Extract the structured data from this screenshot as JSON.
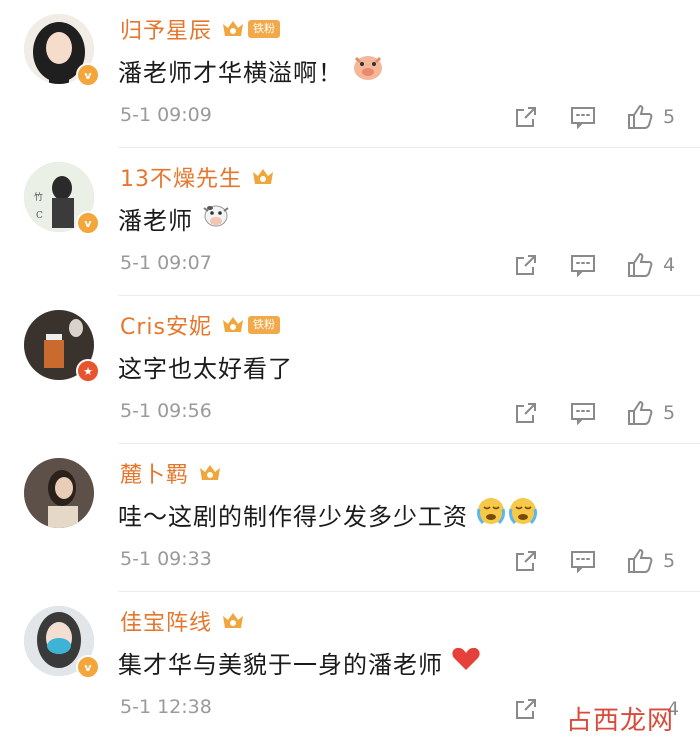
{
  "comments": [
    {
      "name": "归予星辰",
      "fan_tag": "铁粉",
      "text": "潘老师才华横溢啊！",
      "time": "5-1 09:09",
      "likes": "5",
      "badge": "v",
      "badge_color": "#f2a63b",
      "avatar_color": "#2b2b2b",
      "emoji": "pig"
    },
    {
      "name": "13不燥先生",
      "fan_tag": "",
      "text": "潘老师",
      "time": "5-1 09:07",
      "likes": "4",
      "badge": "v",
      "badge_color": "#f2a63b",
      "avatar_color": "#e9efe3",
      "emoji": "cow"
    },
    {
      "name": "Cris安妮",
      "fan_tag": "铁粉",
      "text": "这字也太好看了",
      "time": "5-1 09:56",
      "likes": "5",
      "badge": "star",
      "badge_color": "#e8542e",
      "avatar_color": "#4a4038",
      "emoji": ""
    },
    {
      "name": "麓卜羁",
      "fan_tag": "",
      "text": "哇～这剧的制作得少发多少工资",
      "time": "5-1 09:33",
      "likes": "5",
      "badge": "",
      "badge_color": "",
      "avatar_color": "#6a5a4e",
      "emoji": "cry2"
    },
    {
      "name": "佳宝阵线",
      "fan_tag": "",
      "text": "集才华与美貌于一身的潘老师",
      "time": "5-1 12:38",
      "likes": "4",
      "badge": "v",
      "badge_color": "#f2a63b",
      "avatar_color": "#cfd3d6",
      "emoji": "heart"
    }
  ],
  "icons": {
    "share": "share-icon",
    "reply": "comment-icon",
    "like": "thumbs-up-icon",
    "crown": "crown-icon"
  },
  "colors": {
    "name": "#e6762c",
    "text": "#1b1b1b",
    "meta": "#9a9a9a"
  },
  "watermark": "占西龙网"
}
